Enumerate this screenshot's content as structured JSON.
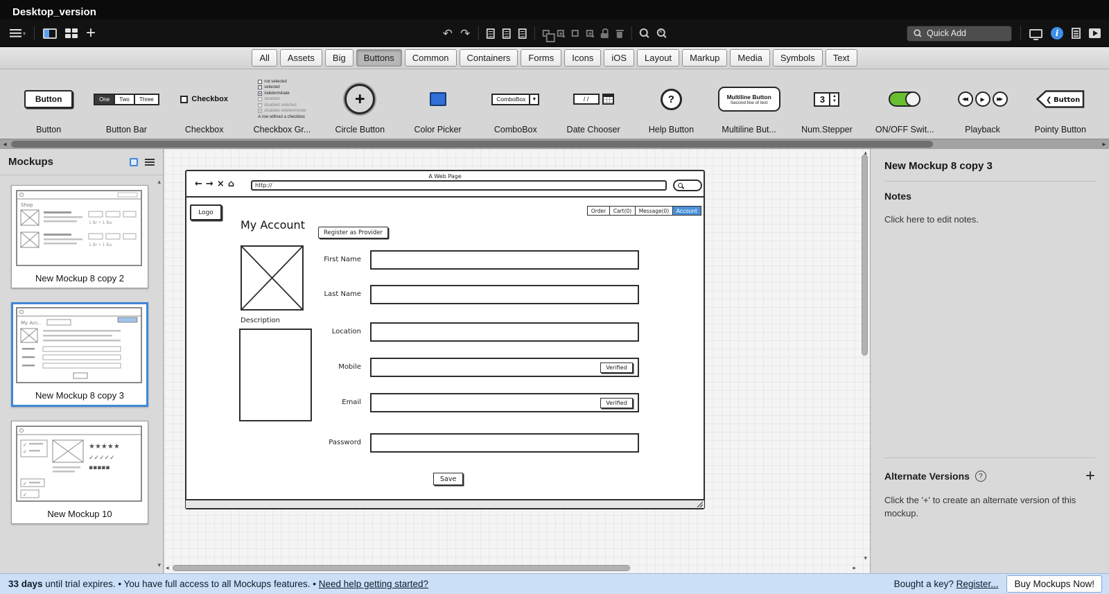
{
  "titlebar": {
    "title": "Desktop_version"
  },
  "toolbar": {
    "quick_add_placeholder": "Quick Add"
  },
  "category_tabs": {
    "items": [
      "All",
      "Assets",
      "Big",
      "Buttons",
      "Common",
      "Containers",
      "Forms",
      "Icons",
      "iOS",
      "Layout",
      "Markup",
      "Media",
      "Symbols",
      "Text"
    ],
    "selected": "Buttons"
  },
  "palette": {
    "items": [
      {
        "label": "Button"
      },
      {
        "label": "Button Bar"
      },
      {
        "label": "Checkbox"
      },
      {
        "label": "Checkbox Gr..."
      },
      {
        "label": "Circle Button"
      },
      {
        "label": "Color Picker"
      },
      {
        "label": "ComboBox"
      },
      {
        "label": "Date Chooser"
      },
      {
        "label": "Help Button"
      },
      {
        "label": "Multiline But..."
      },
      {
        "label": "Num.Stepper"
      },
      {
        "label": "ON/OFF Swit..."
      },
      {
        "label": "Playback"
      },
      {
        "label": "Pointy Button"
      }
    ],
    "previews": {
      "button_text": "Button",
      "bar_segments": [
        "One",
        "Two",
        "Three"
      ],
      "checkbox_text": "Checkbox",
      "checkbox_group_rows": [
        "not selected",
        "selected",
        "indeterminate",
        "disabled",
        "disabled selected",
        "disabled indeterminate",
        "A row without a checkbox"
      ],
      "circle_plus": "+",
      "combo_text": "ComboBox",
      "combo_arrow": "▼",
      "date_text": "/ /",
      "help_text": "?",
      "multiline_line1": "Multiline Button",
      "multiline_line2": "Second line of text",
      "stepper_value": "3",
      "pointy_text": "Button"
    }
  },
  "mockups_panel": {
    "title": "Mockups",
    "items": [
      {
        "label": "New Mockup 8 copy 2"
      },
      {
        "label": "New Mockup 8 copy 3"
      },
      {
        "label": "New Mockup 10"
      }
    ],
    "selected": "New Mockup 8 copy 3"
  },
  "browser": {
    "title": "A Web Page",
    "url": "http://",
    "logo": "Logo",
    "tabs": [
      "Order",
      "Cart(0)",
      "Message(0)",
      "Account"
    ],
    "selected_tab": "Account",
    "heading": "My Account",
    "register_button": "Register as Provider",
    "description_label": "Description",
    "fields": [
      {
        "label": "First Name"
      },
      {
        "label": "Last Name"
      },
      {
        "label": "Location"
      },
      {
        "label": "Mobile",
        "badge": "Verified"
      },
      {
        "label": "Email",
        "badge": "Verified"
      },
      {
        "label": "Password"
      }
    ],
    "save_button": "Save"
  },
  "inspector": {
    "title": "New Mockup 8 copy 3",
    "notes_heading": "Notes",
    "notes_text": "Click here to edit notes.",
    "alternate_heading": "Alternate Versions",
    "help_symbol": "?",
    "add_symbol": "+",
    "alternate_hint": "Click the '+' to create an alternate version of this mockup."
  },
  "statusbar": {
    "trial_bold": "33 days",
    "trial_text": " until trial expires. • You have full access to all Mockups features. • ",
    "help_link": "Need help getting started?",
    "key_text": "Bought a key? ",
    "register_link": "Register...",
    "buy_button": "Buy Mockups Now!"
  }
}
